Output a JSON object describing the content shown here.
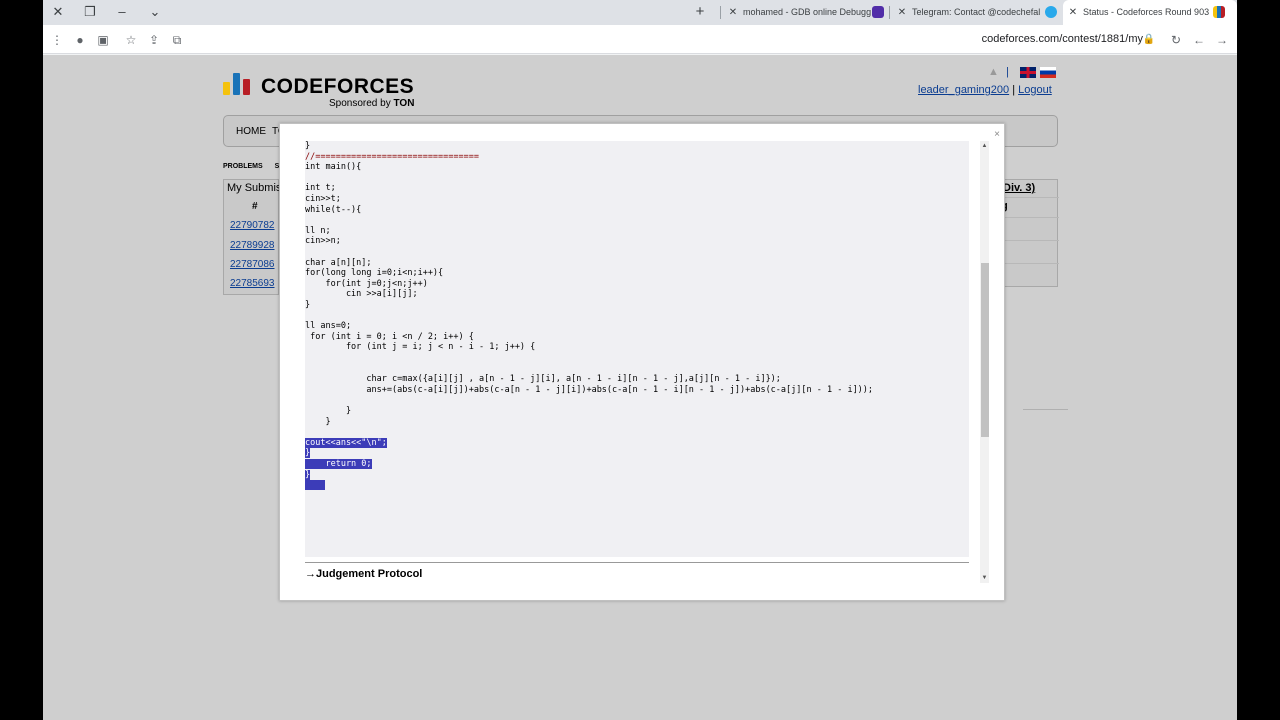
{
  "browser": {
    "tabs": [
      {
        "label": "mohamed - GDB online Debugg",
        "favicon_color": "#512da8"
      },
      {
        "label": "Telegram: Contact @codechefal",
        "favicon_color": "#29a9eb"
      },
      {
        "label": "Status - Codeforces Round 903",
        "favicon_color": "#f4c20d"
      }
    ],
    "new_tab_icon": "+",
    "url": "codeforces.com/contest/1881/my"
  },
  "site": {
    "logo_text": "CODEFORCES",
    "sponsor_text": "Sponsored by",
    "sponsor_name": "TON",
    "username": "leader_gaming200",
    "separator": "|",
    "logout": "Logout",
    "nav_home": "HOME",
    "nav_partial": "TO",
    "subnav_problems": "PROBLEMS",
    "subnav_submit": "SUB"
  },
  "submissions": {
    "title": "My Submis",
    "hash": "#",
    "ids": [
      "22790782",
      "22789928",
      "22787086",
      "22785693"
    ]
  },
  "contest_panel": {
    "title": "Div. 3)",
    "row_text": "g"
  },
  "modal": {
    "close": "×",
    "judgement": "→Judgement Protocol"
  },
  "code": {
    "l01": "}",
    "l02": "//================================",
    "l03": "int main(){",
    "l05": "int t;",
    "l06": "cin>>t;",
    "l07": "while(t--){",
    "l09": "ll n;",
    "l10": "cin>>n;",
    "l12": "char a[n][n];",
    "l13": "for(long long i=0;i<n;i++){",
    "l14": "    for(int j=0;j<n;j++)",
    "l15": "        cin >>a[i][j];",
    "l16": "}",
    "l18": "ll ans=0;",
    "l19": " for (int i = 0; i <n / 2; i++) {",
    "l20": "        for (int j = i; j < n - i - 1; j++) {",
    "l23": "            char c=max({a[i][j] , a[n - 1 - j][i], a[n - 1 - i][n - 1 - j],a[j][n - 1 - i]});",
    "l24": "            ans+=(abs(c-a[i][j])+abs(c-a[n - 1 - j][i])+abs(c-a[n - 1 - i][n - 1 - j])+abs(c-a[j][n - 1 - i]));",
    "l26": "        }",
    "l27": "    }",
    "l29": "cout<<ans<<\"\\n\";",
    "l30": "}",
    "l31": "    return 0;",
    "l32": "}",
    "l33": "    "
  },
  "colors": {
    "keyword": "#000088",
    "comment": "#880000",
    "string": "#008800",
    "selection": "#3c3cb8",
    "logo_bars": [
      "#f4c20d",
      "#1a73b8",
      "#b81f26"
    ]
  }
}
